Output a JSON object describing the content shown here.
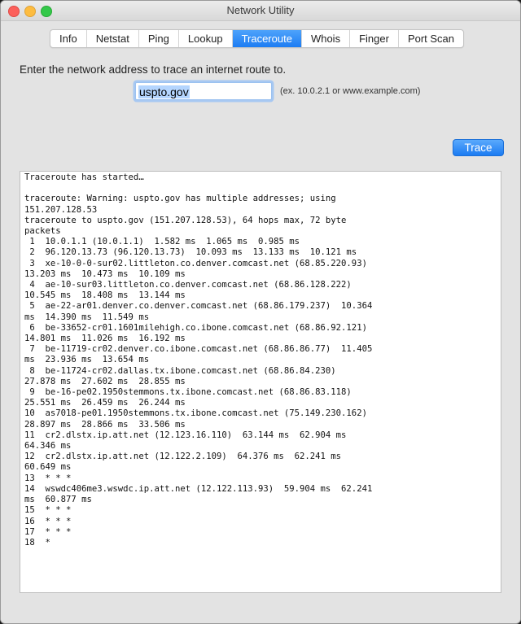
{
  "window": {
    "title": "Network Utility"
  },
  "tabs": [
    {
      "label": "Info",
      "active": false
    },
    {
      "label": "Netstat",
      "active": false
    },
    {
      "label": "Ping",
      "active": false
    },
    {
      "label": "Lookup",
      "active": false
    },
    {
      "label": "Traceroute",
      "active": true
    },
    {
      "label": "Whois",
      "active": false
    },
    {
      "label": "Finger",
      "active": false
    },
    {
      "label": "Port Scan",
      "active": false
    }
  ],
  "form": {
    "prompt": "Enter the network address to trace an internet route to.",
    "address_value": "uspto.gov",
    "hint": "(ex. 10.0.2.1 or www.example.com)",
    "trace_label": "Trace"
  },
  "output": {
    "lines": [
      "Traceroute has started…",
      "",
      "traceroute: Warning: uspto.gov has multiple addresses; using",
      "151.207.128.53",
      "traceroute to uspto.gov (151.207.128.53), 64 hops max, 72 byte",
      "packets",
      " 1  10.0.1.1 (10.0.1.1)  1.582 ms  1.065 ms  0.985 ms",
      " 2  96.120.13.73 (96.120.13.73)  10.093 ms  13.133 ms  10.121 ms",
      " 3  xe-10-0-0-sur02.littleton.co.denver.comcast.net (68.85.220.93)",
      "13.203 ms  10.473 ms  10.109 ms",
      " 4  ae-10-sur03.littleton.co.denver.comcast.net (68.86.128.222)",
      "10.545 ms  18.408 ms  13.144 ms",
      " 5  ae-22-ar01.denver.co.denver.comcast.net (68.86.179.237)  10.364",
      "ms  14.390 ms  11.549 ms",
      " 6  be-33652-cr01.1601milehigh.co.ibone.comcast.net (68.86.92.121)",
      "14.801 ms  11.026 ms  16.192 ms",
      " 7  be-11719-cr02.denver.co.ibone.comcast.net (68.86.86.77)  11.405",
      "ms  23.936 ms  13.654 ms",
      " 8  be-11724-cr02.dallas.tx.ibone.comcast.net (68.86.84.230)",
      "27.878 ms  27.602 ms  28.855 ms",
      " 9  be-16-pe02.1950stemmons.tx.ibone.comcast.net (68.86.83.118)",
      "25.551 ms  26.459 ms  26.244 ms",
      "10  as7018-pe01.1950stemmons.tx.ibone.comcast.net (75.149.230.162)",
      "28.897 ms  28.866 ms  33.506 ms",
      "11  cr2.dlstx.ip.att.net (12.123.16.110)  63.144 ms  62.904 ms",
      "64.346 ms",
      "12  cr2.dlstx.ip.att.net (12.122.2.109)  64.376 ms  62.241 ms",
      "60.649 ms",
      "13  * * *",
      "14  wswdc406me3.wswdc.ip.att.net (12.122.113.93)  59.904 ms  62.241",
      "ms  60.877 ms",
      "15  * * *",
      "16  * * *",
      "17  * * *",
      "18  *"
    ]
  }
}
